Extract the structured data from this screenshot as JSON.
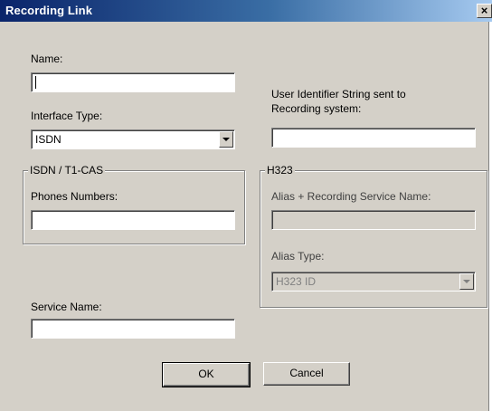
{
  "window": {
    "title": "Recording Link",
    "close_glyph": "×"
  },
  "name_field": {
    "label": "Name:",
    "value": ""
  },
  "user_identifier": {
    "label_line1": "User Identifier String sent to",
    "label_line2": "Recording system:",
    "value": ""
  },
  "interface_type": {
    "label": "Interface Type:",
    "selected": "ISDN"
  },
  "isdn_group": {
    "legend": "ISDN / T1-CAS",
    "phones_label": "Phones  Numbers:",
    "phones_value": ""
  },
  "h323_group": {
    "legend": "H323",
    "alias_label": "Alias + Recording Service Name:",
    "alias_value": "",
    "alias_type_label": "Alias Type:",
    "alias_type_selected": "H323 ID"
  },
  "service_name": {
    "label": "Service Name:",
    "value": ""
  },
  "buttons": {
    "ok": "OK",
    "cancel": "Cancel"
  }
}
